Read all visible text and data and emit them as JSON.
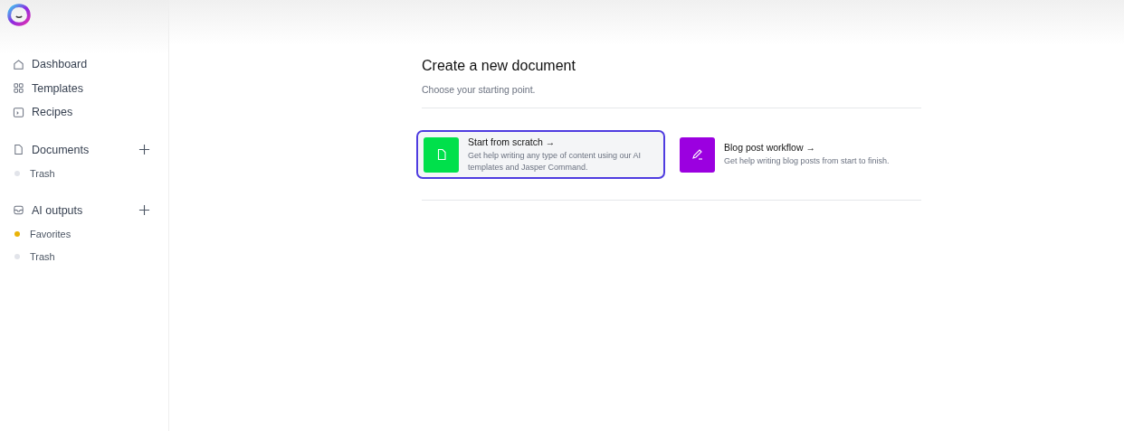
{
  "sidebar": {
    "nav": [
      {
        "label": "Dashboard",
        "kind": "home"
      },
      {
        "label": "Templates",
        "kind": "grid"
      },
      {
        "label": "Recipes",
        "kind": "terminal"
      }
    ],
    "sections": [
      {
        "label": "Documents",
        "kind": "doc",
        "items": [
          {
            "label": "Trash",
            "color": "#e2e4ea"
          }
        ]
      },
      {
        "label": "AI outputs",
        "kind": "inbox",
        "items": [
          {
            "label": "Favorites",
            "color": "#e9b308"
          },
          {
            "label": "Trash",
            "color": "#e2e4ea"
          }
        ]
      }
    ]
  },
  "main": {
    "title": "Create a new document",
    "subtitle": "Choose your starting point.",
    "options": [
      {
        "title": "Start from scratch →",
        "description": "Get help writing any type of content using our AI templates and Jasper Command.",
        "kind": "doc",
        "color": "#00e04b",
        "selected": true
      },
      {
        "title": "Blog post workflow →",
        "description": "Get help writing blog posts from start to finish.",
        "kind": "pen",
        "color": "#9b00e0",
        "selected": false
      }
    ]
  }
}
